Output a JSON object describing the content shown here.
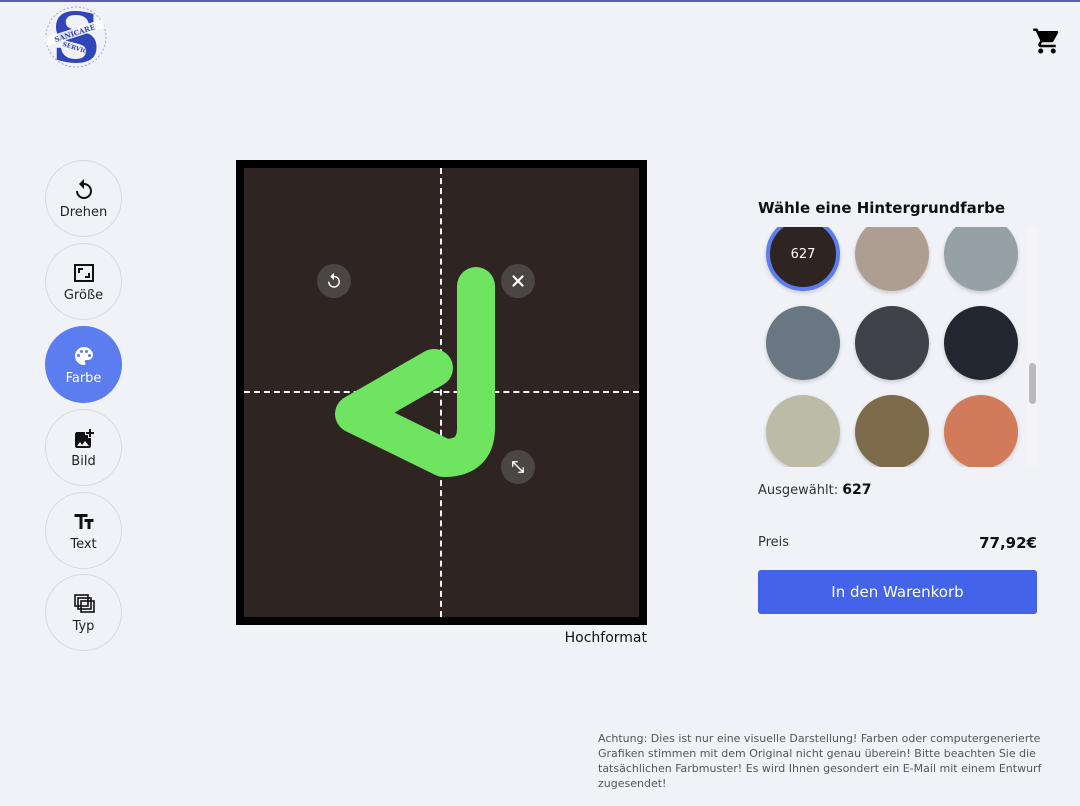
{
  "logo": {
    "line1": "SANICARE",
    "line2": "SERVICE",
    "letter": "S"
  },
  "cart_icon": "shopping-cart-icon",
  "tools": [
    {
      "label": "Drehen",
      "icon": "rotate-icon"
    },
    {
      "label": "Größe",
      "icon": "resize-frame-icon"
    },
    {
      "label": "Farbe",
      "icon": "palette-icon"
    },
    {
      "label": "Bild",
      "icon": "add-image-icon"
    },
    {
      "label": "Text",
      "icon": "text-icon"
    },
    {
      "label": "Typ",
      "icon": "layers-icon"
    }
  ],
  "canvas": {
    "background_color": "#2e2523",
    "frame_color": "#000000",
    "shape_color": "#6ee460",
    "controls": [
      "rotate-icon",
      "close-icon",
      "resize-diagonal-icon"
    ],
    "orientation": "Hochformat"
  },
  "color_picker": {
    "title": "Wähle eine Hintergrundfarbe",
    "swatches": [
      {
        "code": "627",
        "color": "#2e2523",
        "selected": true
      },
      {
        "code": "",
        "color": "#ae9d91"
      },
      {
        "code": "",
        "color": "#95a1a5"
      },
      {
        "code": "",
        "color": "#6a7681"
      },
      {
        "code": "",
        "color": "#3f4349"
      },
      {
        "code": "",
        "color": "#22262e"
      },
      {
        "code": "",
        "color": "#bcbba6"
      },
      {
        "code": "",
        "color": "#7d6b4c"
      },
      {
        "code": "",
        "color": "#d27b5a"
      }
    ],
    "selected_label": "Ausgewählt:",
    "selected_value": "627"
  },
  "price": {
    "label": "Preis",
    "value": "77,92€"
  },
  "add_to_cart": "In den Warenkorb",
  "accent_color": "#4364e9",
  "disclaimer": "Achtung: Dies ist nur eine visuelle Darstellung! Farben oder computergenerierte Grafiken stimmen mit dem Original nicht genau überein! Bitte beachten Sie die tatsächlichen Farbmuster! Es wird Ihnen gesondert ein E-Mail mit einem Entwurf zugesendet!"
}
